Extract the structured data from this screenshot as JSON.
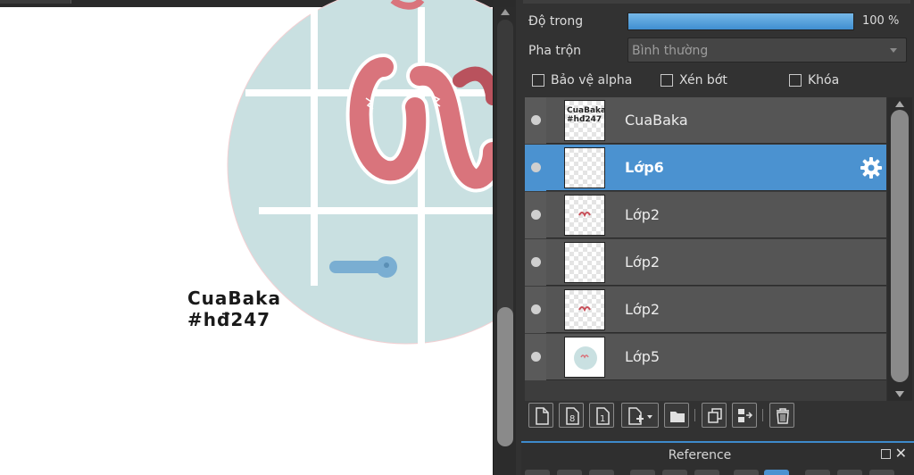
{
  "layer_props": {
    "opacity_label": "Độ trong",
    "opacity_percent": 100,
    "opacity_value": "100 %",
    "blend_label": "Pha trộn",
    "blend_value": "Bình thường",
    "protect_alpha": {
      "label": "Bảo vệ alpha",
      "checked": false
    },
    "clipping": {
      "label": "Xén bớt",
      "checked": false
    },
    "lock": {
      "label": "Khóa",
      "checked": false
    }
  },
  "layers": [
    {
      "name": "CuaBaka",
      "visible": true,
      "selected": false,
      "thumb": "text"
    },
    {
      "name": "Lớp6",
      "visible": true,
      "selected": true,
      "thumb": "empty"
    },
    {
      "name": "Lớp2",
      "visible": true,
      "selected": false,
      "thumb": "tiny-art"
    },
    {
      "name": "Lớp2",
      "visible": true,
      "selected": false,
      "thumb": "empty"
    },
    {
      "name": "Lớp2",
      "visible": true,
      "selected": false,
      "thumb": "tiny-art"
    },
    {
      "name": "Lớp5",
      "visible": true,
      "selected": false,
      "thumb": "circle"
    }
  ],
  "canvas": {
    "signature_line1": "CuaBaka",
    "signature_line2": "#hđ247"
  },
  "toolbar_icons": [
    "new-layer-icon",
    "new-8bit-layer-icon",
    "new-1bit-layer-icon",
    "add-layer-menu-icon",
    "folder-icon",
    "duplicate-layer-icon",
    "merge-down-icon",
    "delete-layer-icon"
  ],
  "reference_panel": {
    "title": "Reference"
  },
  "colors": {
    "accent": "#4b92d0",
    "circle": "#c9e0e1",
    "ribbon": "#d9747c",
    "ribbon_dark": "#b9525d",
    "pin": "#7aaed2"
  }
}
